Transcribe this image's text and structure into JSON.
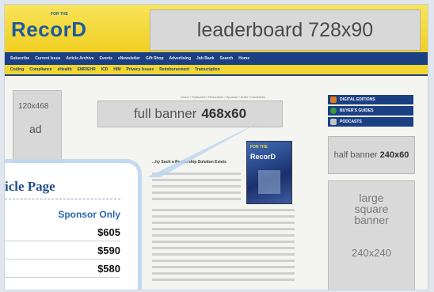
{
  "header": {
    "logo_small": "FOR THE",
    "logo": "RecorD",
    "leaderboard": "leaderboard 728x90"
  },
  "nav_primary": [
    "Subscribe",
    "Current Issue",
    "Article Archive",
    "Events",
    "eNewsletter",
    "Gift Shop",
    "Advertising",
    "Job Bank",
    "Search",
    "Home"
  ],
  "nav_secondary": [
    "Coding",
    "Compliance",
    "eHealth",
    "EMR/EHR",
    "ICD",
    "HIM",
    "Privacy Issues",
    "Reimbursement",
    "Transcription"
  ],
  "left_ad": {
    "size": "120x468",
    "glyph": "ad"
  },
  "breadcrumb": "Home / Subscribe / Resources / Sponsor / Artist / Guidelines",
  "full_banner": {
    "label": "full banner",
    "size": "468x60"
  },
  "article": {
    "headline": "...hy Such a Readership Solution Exists"
  },
  "magazine_cover": {
    "brand": "FOR THE",
    "name": "RecorD"
  },
  "right_column": {
    "buttons": [
      {
        "label": "DIGITAL EDITIONS",
        "icon": "book-icon",
        "color": "#e07b1a"
      },
      {
        "label": "BUYER'S GUIDES",
        "icon": "globe-icon",
        "color": "#3c9b3c"
      },
      {
        "label": "PODCASTS",
        "icon": "microphone-icon",
        "color": "#c4c4c4"
      }
    ],
    "half_banner": {
      "label": "half banner",
      "size": "240x60"
    },
    "square": {
      "lines": [
        "large",
        "square",
        "banner"
      ],
      "size": "240x240"
    }
  },
  "callout": {
    "title": "icle Page",
    "column_header": "Sponsor Only",
    "prices": [
      "$605",
      "$590",
      "$580"
    ]
  }
}
